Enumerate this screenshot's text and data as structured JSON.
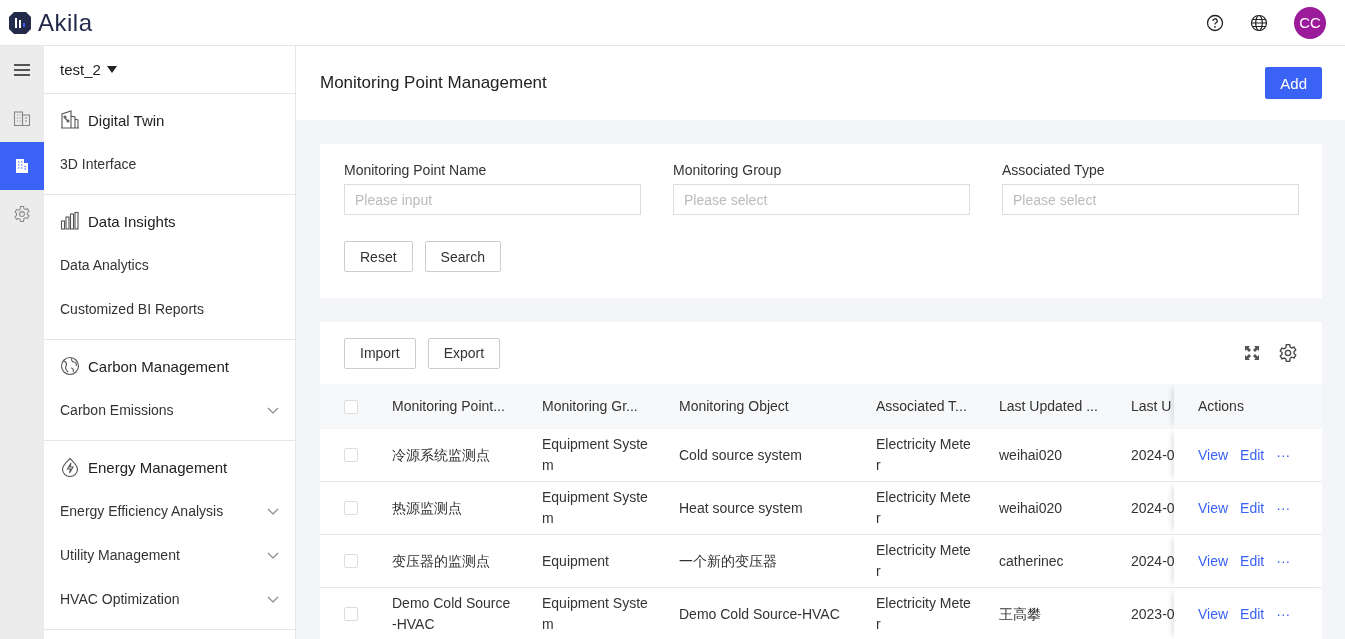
{
  "header": {
    "logo_text": "Akila",
    "avatar": "CC"
  },
  "rail": [
    {
      "kind": "buildings",
      "selected": false
    },
    {
      "kind": "building",
      "selected": true
    },
    {
      "kind": "settings",
      "selected": false
    }
  ],
  "workspace": "test_2",
  "sidebar": [
    {
      "title": "Digital Twin",
      "items": [
        {
          "label": "3D Interface",
          "expandable": false
        }
      ]
    },
    {
      "title": "Data Insights",
      "items": [
        {
          "label": "Data Analytics",
          "expandable": false
        },
        {
          "label": "Customized BI Reports",
          "expandable": false
        }
      ]
    },
    {
      "title": "Carbon Management",
      "items": [
        {
          "label": "Carbon Emissions",
          "expandable": true
        }
      ]
    },
    {
      "title": "Energy Management",
      "items": [
        {
          "label": "Energy Efficiency Analysis",
          "expandable": true
        },
        {
          "label": "Utility Management",
          "expandable": true
        },
        {
          "label": "HVAC Optimization",
          "expandable": true
        }
      ]
    }
  ],
  "page": {
    "title": "Monitoring Point Management",
    "add_button": "Add"
  },
  "filters": [
    {
      "label": "Monitoring Point Name",
      "placeholder": "Please input"
    },
    {
      "label": "Monitoring Group",
      "placeholder": "Please select"
    },
    {
      "label": "Associated Type",
      "placeholder": "Please select"
    }
  ],
  "filter_buttons": [
    "Reset",
    "Search"
  ],
  "table_buttons": [
    "Import",
    "Export"
  ],
  "table": {
    "columns": [
      "Monitoring Point...",
      "Monitoring Gr...",
      "Monitoring Object",
      "Associated T...",
      "Last Updated ...",
      "Last U",
      "Actions"
    ],
    "header_checked": false,
    "rows": [
      {
        "checked": false,
        "cells": [
          "冷源系统监测点",
          "Equipment System",
          "Cold source system",
          "Electricity Meter",
          "weihai020",
          "2024-0"
        ],
        "actions": [
          "View",
          "Edit",
          "···"
        ]
      },
      {
        "checked": false,
        "cells": [
          "热源监测点",
          "Equipment System",
          "Heat source system",
          "Electricity Meter",
          "weihai020",
          "2024-0"
        ],
        "actions": [
          "View",
          "Edit",
          "···"
        ]
      },
      {
        "checked": false,
        "cells": [
          "变压器的监测点",
          "Equipment",
          "一个新的变压器",
          "Electricity Meter",
          "catherinec",
          "2024-0"
        ],
        "actions": [
          "View",
          "Edit",
          "···"
        ]
      },
      {
        "checked": false,
        "cells": [
          "Demo Cold Source -HVAC",
          "Equipment System",
          "Demo Cold Source-HVAC",
          "Electricity Meter",
          "王高攀",
          "2023-0"
        ],
        "actions": [
          "View",
          "Edit",
          "···"
        ]
      }
    ]
  }
}
